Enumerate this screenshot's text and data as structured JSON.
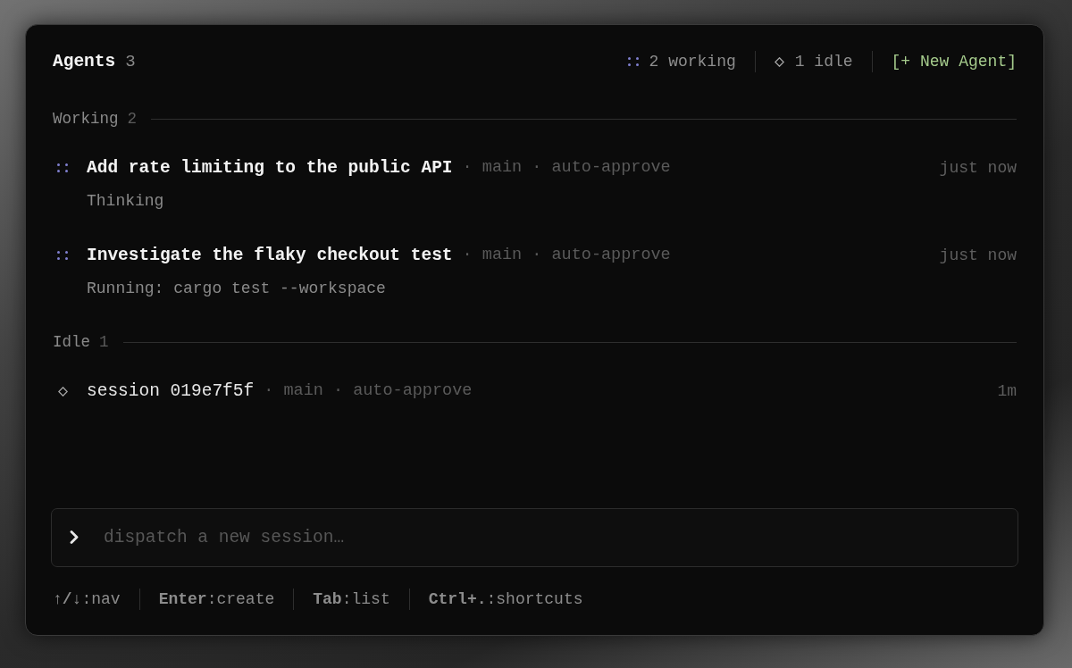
{
  "header": {
    "title": "Agents",
    "count": "3",
    "stats": [
      {
        "kind": "working",
        "label": "2 working"
      },
      {
        "kind": "idle",
        "label": "1 idle"
      }
    ],
    "new_button": "[+ New Agent]"
  },
  "sections": [
    {
      "kind": "working",
      "label": "Working",
      "count": "2",
      "agents": [
        {
          "title": "Add rate limiting to the public API",
          "details": "· main · auto-approve",
          "time": "just now",
          "status": "Thinking"
        },
        {
          "title": "Investigate the flaky checkout test",
          "details": "· main · auto-approve",
          "time": "just now",
          "status": "Running: cargo test --workspace"
        }
      ]
    },
    {
      "kind": "idle",
      "label": "Idle",
      "count": "1",
      "agents": [
        {
          "title": "session 019e7f5f",
          "details": "· main · auto-approve",
          "time": "1m"
        }
      ]
    }
  ],
  "input": {
    "placeholder": "dispatch a new session…"
  },
  "shortcuts": [
    "**↑/↓**:nav",
    "**Enter**:create",
    "**Tab**:list",
    "**Ctrl+.**:shortcuts"
  ]
}
